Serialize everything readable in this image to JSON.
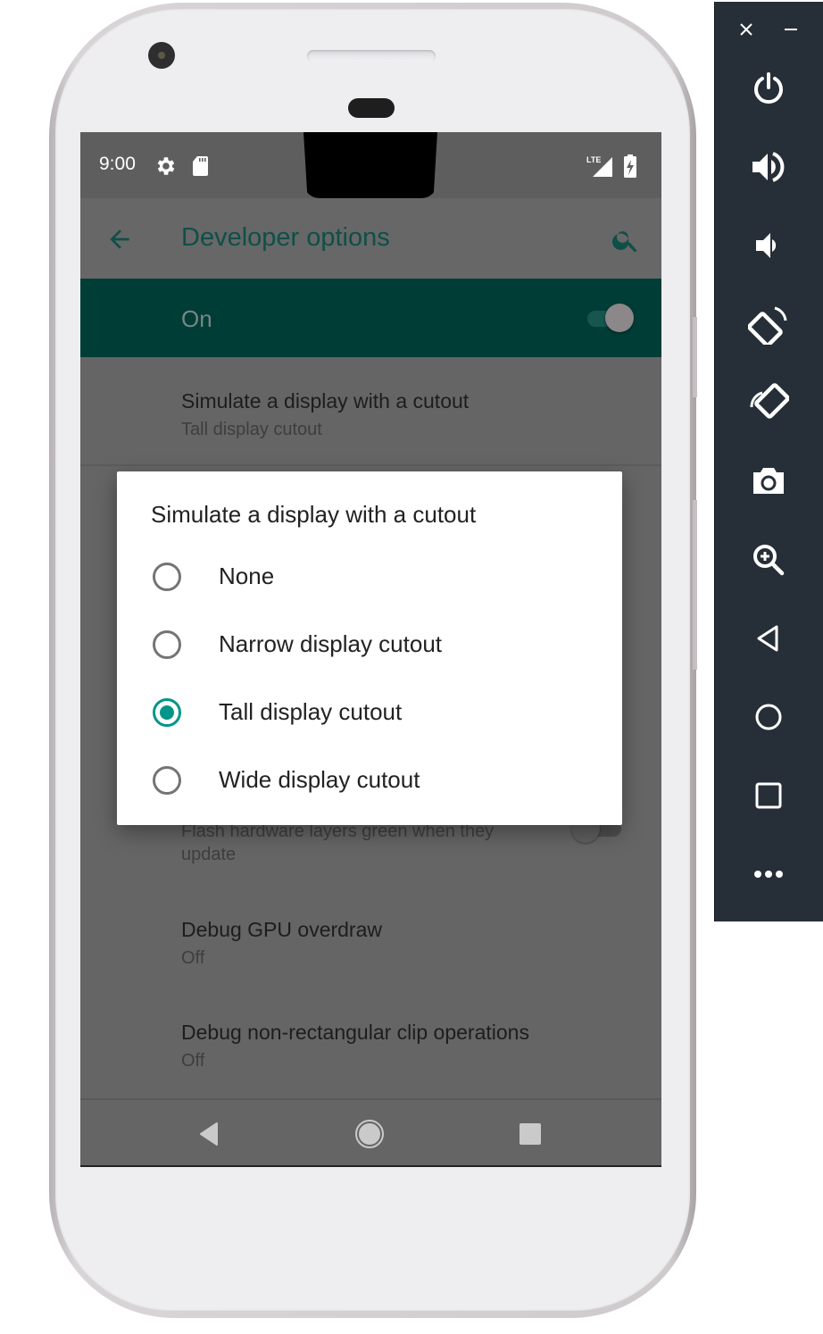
{
  "status_bar": {
    "time": "9:00",
    "left_icons": [
      "settings-icon",
      "sd-card-icon"
    ],
    "right_icons": [
      "lte-signal-icon",
      "battery-charging-icon"
    ],
    "network_label": "LTE"
  },
  "app_bar": {
    "title": "Developer options",
    "back_icon": "arrow-back-icon",
    "search_icon": "search-icon"
  },
  "master_switch": {
    "label": "On",
    "checked": true
  },
  "preferences": [
    {
      "title": "Simulate a display with a cutout",
      "summary": "Tall display cutout"
    },
    {
      "title": "",
      "summary": "Flash hardware layers green when they update",
      "summary_line1": "Flash hardware layers green when they",
      "summary_line2": "update",
      "switch_checked": false
    },
    {
      "title": "Debug GPU overdraw",
      "summary": "Off"
    },
    {
      "title": "Debug non-rectangular clip operations",
      "summary": "Off"
    }
  ],
  "dialog": {
    "title": "Simulate a display with a cutout",
    "options": [
      {
        "label": "None",
        "selected": false
      },
      {
        "label": "Narrow display cutout",
        "selected": false
      },
      {
        "label": "Tall display cutout",
        "selected": true
      },
      {
        "label": "Wide display cutout",
        "selected": false
      }
    ]
  },
  "nav_bar": {
    "buttons": [
      "back",
      "home",
      "recents"
    ]
  },
  "emulator_toolbar": {
    "window_controls": [
      "close",
      "minimize"
    ],
    "buttons": [
      "power",
      "volume-up",
      "volume-down",
      "rotate-left",
      "rotate-right",
      "screenshot",
      "zoom",
      "back",
      "home",
      "overview",
      "more"
    ]
  },
  "colors": {
    "accent": "#009688",
    "master_bar": "#003d37",
    "title_text": "#0f4f48",
    "toolbar_bg": "#262f37",
    "scrim_bg": "#656565"
  }
}
